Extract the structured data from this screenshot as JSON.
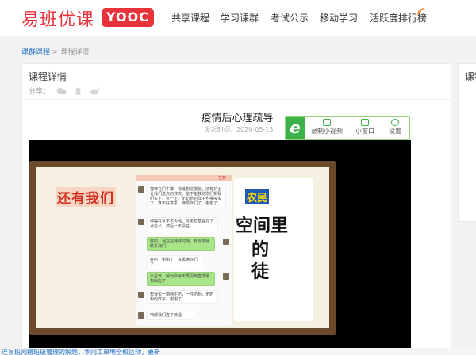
{
  "brand": {
    "name": "易班优课",
    "badge": "YOOC"
  },
  "nav": [
    "共享课程",
    "学习课群",
    "考试公示",
    "移动学习",
    "活跃度排行榜"
  ],
  "breadcrumb": {
    "parent": "课群课程",
    "sep": ">",
    "current": "课程详情"
  },
  "card": {
    "title": "课程详情",
    "share_label": "分享："
  },
  "side_card": {
    "title": "课程"
  },
  "course": {
    "title": "疫情后心理疏导",
    "date": "发起时间：2020-05-13"
  },
  "toolbar": {
    "logo": "e",
    "items": [
      "录制小视频",
      "小窗口",
      "设置"
    ]
  },
  "video": {
    "board_title": "还有我们",
    "chat_header": "在药",
    "messages": [
      "猫咪在们牛群，我挺想这俄友，还有护士让我们送点的救灾，能不能救助您们捐我们实下。这一下。无奶粉的样子也得吸实下，真不好意思，麻烦你们了，谢谢了。",
      "他得在处不下否强，今天粒草喜在了点位公，然后一天没在。",
      "好的，我在是特殊时期，有需求就联系我们",
      "好的，谢谢了，真黑猫你们了。",
      "不是气，解劝你每天再况到直体最刻出应了",
      "帮我买一箱纯牛奶，一件奶粉，无奶粉的样子，谢谢了",
      "咱帮我们连了体温"
    ],
    "poster_lines": [
      "农民",
      "空间里",
      "的",
      "徒"
    ]
  },
  "status_text": "连易班网络班级管理的解题，本问工单地全权运动，更新"
}
